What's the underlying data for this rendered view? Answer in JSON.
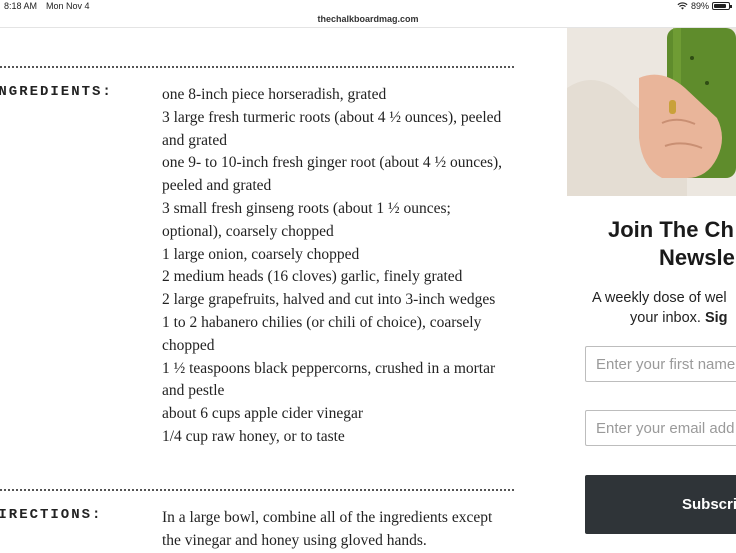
{
  "status_bar": {
    "time": "8:18 AM",
    "date": "Mon Nov 4",
    "battery_percent": "89%",
    "battery_level": 0.89
  },
  "browser": {
    "url": "thechalkboardmag.com"
  },
  "recipe": {
    "ingredients_label": "INGREDIENTS:",
    "ingredients": [
      "one 8-inch piece horseradish, grated",
      "3 large fresh turmeric roots (about 4 ½ ounces), peeled and grated",
      "one 9- to 10-inch fresh ginger root (about 4 ½ ounces), peeled and grated",
      "3 small fresh ginseng roots (about 1 ½ ounces; optional), coarsely chopped",
      "1 large onion, coarsely chopped",
      "2 medium heads (16 cloves) garlic, finely grated",
      "2 large grapefruits, halved and cut into 3-inch wedges",
      "1 to 2 habanero chilies (or chili of choice), coarsely chopped",
      "1 ½ teaspoons black peppercorns, crushed in a mortar and pestle",
      "about 6 cups apple cider vinegar",
      "1/4 cup raw honey, or to taste"
    ],
    "directions_label": "DIRECTIONS:",
    "directions_text": "In a large bowl, combine all of the ingredients except the vinegar and honey using gloved hands."
  },
  "newsletter": {
    "title_line1": "Join The Ch",
    "title_line2": "Newsle",
    "desc_line1": "A weekly dose of wel",
    "desc_line2_prefix": "your inbox. ",
    "desc_line2_bold": "Sig",
    "first_name_placeholder": "Enter your first name",
    "email_placeholder": "Enter your email add",
    "subscribe_label": "Subscri"
  },
  "colors": {
    "button_bg": "#2f3438",
    "text": "#1a1a1a"
  }
}
